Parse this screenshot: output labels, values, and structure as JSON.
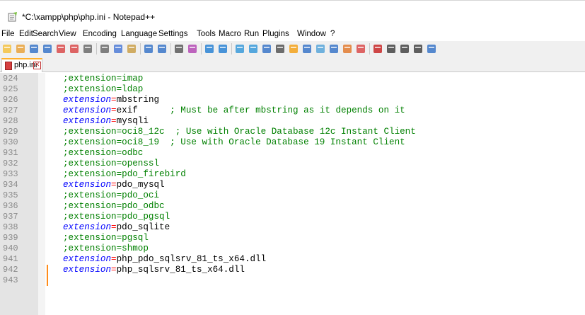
{
  "window": {
    "title": "*C:\\xampp\\php\\php.ini - Notepad++"
  },
  "menu": {
    "items": [
      "File",
      "Edit",
      "Search",
      "View",
      "Encoding",
      "Language",
      "Settings",
      "Tools",
      "Macro",
      "Run",
      "Plugins",
      "Window",
      "?"
    ]
  },
  "toolbar": {
    "buttons": [
      "new-file",
      "open-file",
      "save",
      "save-all",
      "close",
      "close-all",
      "print",
      "cut",
      "copy",
      "paste",
      "undo",
      "redo",
      "find",
      "replace",
      "zoom-in",
      "zoom-out",
      "sync-vertical",
      "sync-horizontal",
      "word-wrap",
      "show-all-chars",
      "indent-guide",
      "udl",
      "doc-map",
      "function-list",
      "folder-as-workspace",
      "monitor",
      "record-macro",
      "stop-record",
      "play-macro",
      "run-macro-multiple",
      "save-macro"
    ]
  },
  "tabs": [
    {
      "label": "php.ini",
      "close": "✕",
      "modified": true
    }
  ],
  "editor": {
    "lines": [
      {
        "num": "924",
        "comment": true,
        "key": "extension",
        "value": "imap"
      },
      {
        "num": "925",
        "comment": true,
        "key": "extension",
        "value": "ldap"
      },
      {
        "num": "926",
        "comment": false,
        "key": "extension",
        "value": "mbstring"
      },
      {
        "num": "927",
        "comment": false,
        "key": "extension",
        "value": "exif",
        "trail": "      ; Must be after mbstring as it depends on it"
      },
      {
        "num": "928",
        "comment": false,
        "key": "extension",
        "value": "mysqli"
      },
      {
        "num": "929",
        "comment": true,
        "key": "extension",
        "value": "oci8_12c",
        "trail": "  ; Use with Oracle Database 12c Instant Client"
      },
      {
        "num": "930",
        "comment": true,
        "key": "extension",
        "value": "oci8_19",
        "trail": "  ; Use with Oracle Database 19 Instant Client"
      },
      {
        "num": "931",
        "comment": true,
        "key": "extension",
        "value": "odbc"
      },
      {
        "num": "932",
        "comment": true,
        "key": "extension",
        "value": "openssl"
      },
      {
        "num": "933",
        "comment": true,
        "key": "extension",
        "value": "pdo_firebird"
      },
      {
        "num": "934",
        "comment": false,
        "key": "extension",
        "value": "pdo_mysql"
      },
      {
        "num": "935",
        "comment": true,
        "key": "extension",
        "value": "pdo_oci"
      },
      {
        "num": "936",
        "comment": true,
        "key": "extension",
        "value": "pdo_odbc"
      },
      {
        "num": "937",
        "comment": true,
        "key": "extension",
        "value": "pdo_pgsql"
      },
      {
        "num": "938",
        "comment": false,
        "key": "extension",
        "value": "pdo_sqlite"
      },
      {
        "num": "939",
        "comment": true,
        "key": "extension",
        "value": "pgsql"
      },
      {
        "num": "940",
        "comment": true,
        "key": "extension",
        "value": "shmop"
      },
      {
        "num": "941",
        "comment": false,
        "key": "extension",
        "value": "php_pdo_sqlsrv_81_ts_x64.dll"
      },
      {
        "num": "942",
        "comment": false,
        "key": "extension",
        "value": "php_sqlsrv_81_ts_x64.dll",
        "changed": true
      },
      {
        "num": "943",
        "comment": false,
        "key": "",
        "value": ""
      }
    ]
  },
  "colors": {
    "comment": "#008000",
    "keyword": "#0000ff",
    "operator": "#ff0000",
    "gutter": "#e4e4e4",
    "line_number": "#8a8a8a",
    "change_marker": "#ff8c1a",
    "tab_accent": "#ffb02e"
  }
}
